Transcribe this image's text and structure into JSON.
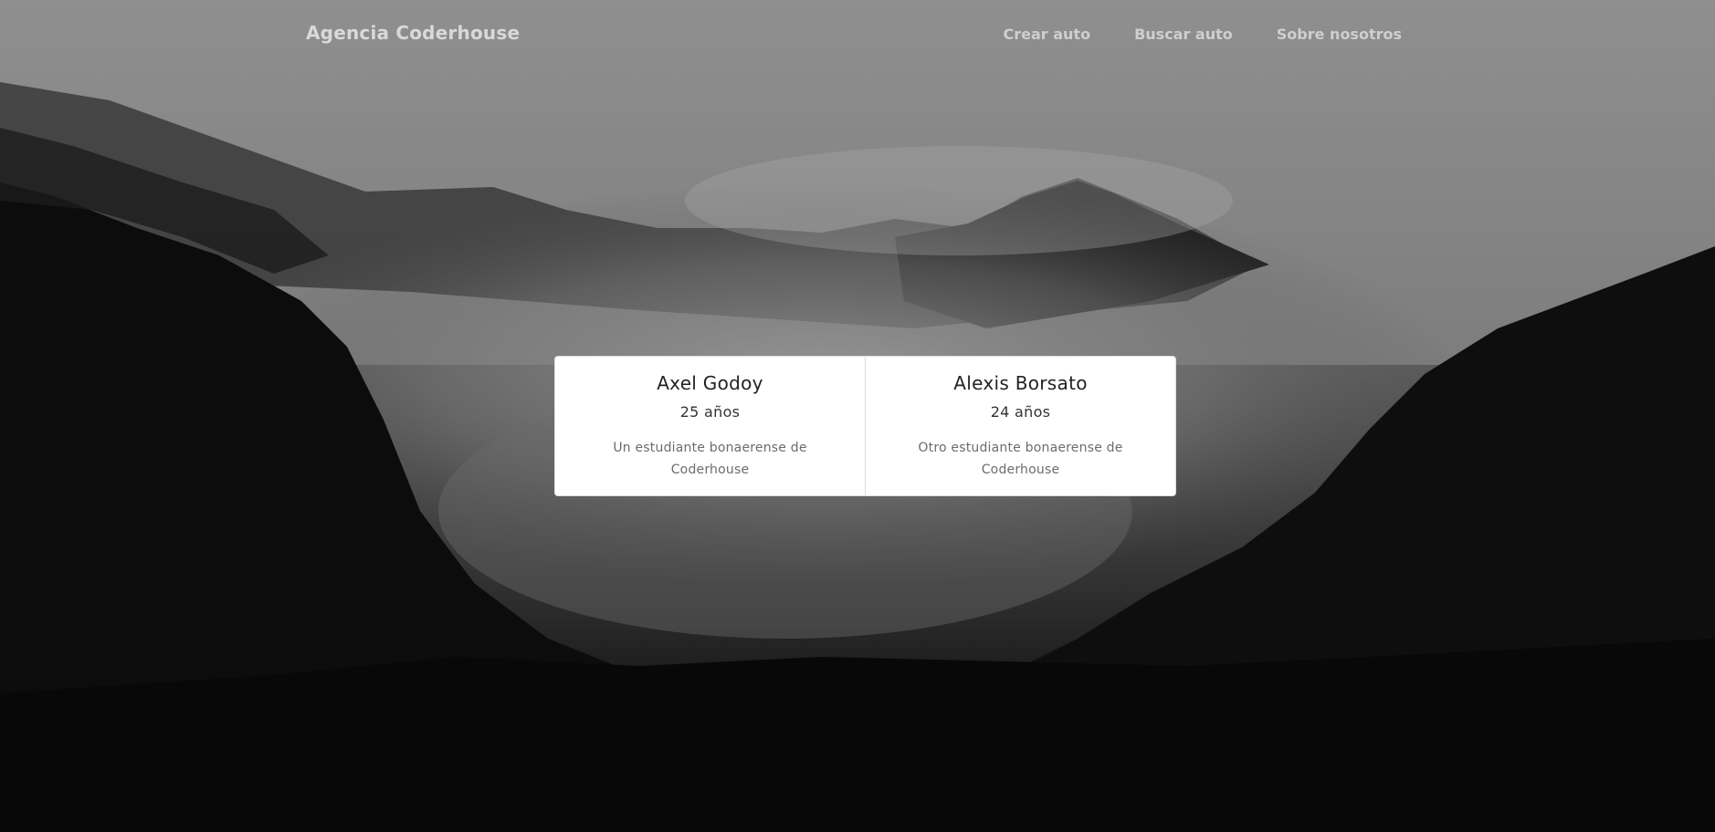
{
  "navbar": {
    "brand": "Agencia Coderhouse",
    "links": [
      {
        "label": "Crear auto"
      },
      {
        "label": "Buscar auto"
      },
      {
        "label": "Sobre nosotros"
      }
    ]
  },
  "cards": [
    {
      "name": "Axel Godoy",
      "age": "25 años",
      "description": "Un estudiante bonaerense de Coderhouse"
    },
    {
      "name": "Alexis Borsato",
      "age": "24 años",
      "description": "Otro estudiante bonaerense de Coderhouse"
    }
  ],
  "colors": {
    "card_background": "#ffffff",
    "navbar_text": "#d9d9d9",
    "muted_text": "#6c6c6c"
  }
}
